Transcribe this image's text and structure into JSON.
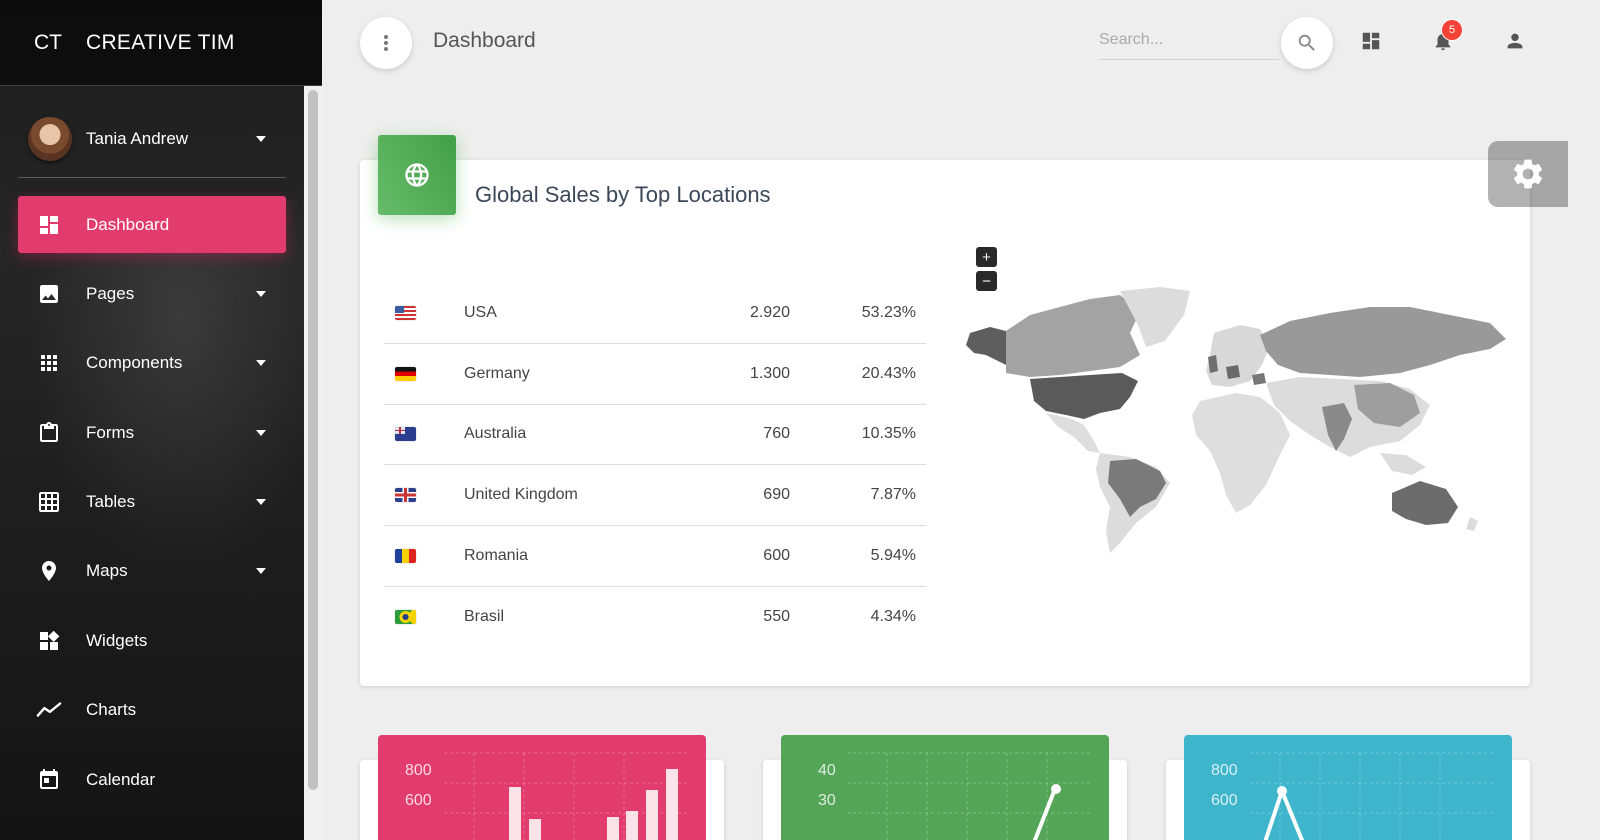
{
  "brand": {
    "mini": "CT",
    "full": "CREATIVE TIM"
  },
  "user": {
    "name": "Tania Andrew"
  },
  "nav": [
    {
      "label": "Dashboard",
      "icon": "dashboard-icon",
      "active": true,
      "caret": false
    },
    {
      "label": "Pages",
      "icon": "image-icon",
      "active": false,
      "caret": true
    },
    {
      "label": "Components",
      "icon": "apps-icon",
      "active": false,
      "caret": true
    },
    {
      "label": "Forms",
      "icon": "clipboard-icon",
      "active": false,
      "caret": true
    },
    {
      "label": "Tables",
      "icon": "grid-icon",
      "active": false,
      "caret": true
    },
    {
      "label": "Maps",
      "icon": "place-icon",
      "active": false,
      "caret": true
    },
    {
      "label": "Widgets",
      "icon": "widgets-icon",
      "active": false,
      "caret": false
    },
    {
      "label": "Charts",
      "icon": "timeline-icon",
      "active": false,
      "caret": false
    },
    {
      "label": "Calendar",
      "icon": "calendar-icon",
      "active": false,
      "caret": false
    }
  ],
  "header": {
    "title": "Dashboard",
    "search_placeholder": "Search...",
    "notification_count": "5"
  },
  "sales": {
    "title": "Global Sales by Top Locations",
    "zoom_in": "+",
    "zoom_out": "−",
    "rows": [
      {
        "country": "USA",
        "amount": "2.920",
        "percent": "53.23%",
        "flag": "us-flag-icon"
      },
      {
        "country": "Germany",
        "amount": "1.300",
        "percent": "20.43%",
        "flag": "de-flag-icon"
      },
      {
        "country": "Australia",
        "amount": "760",
        "percent": "10.35%",
        "flag": "au-flag-icon"
      },
      {
        "country": "United Kingdom",
        "amount": "690",
        "percent": "7.87%",
        "flag": "gb-flag-icon"
      },
      {
        "country": "Romania",
        "amount": "600",
        "percent": "5.94%",
        "flag": "ro-flag-icon"
      },
      {
        "country": "Brasil",
        "amount": "550",
        "percent": "4.34%",
        "flag": "br-flag-icon"
      }
    ]
  },
  "mini_charts": [
    {
      "color": "#e13c6d",
      "ticks": [
        "800",
        "600"
      ]
    },
    {
      "color": "#55a559",
      "ticks": [
        "40",
        "30"
      ]
    },
    {
      "color": "#3eb5cb",
      "ticks": [
        "800",
        "600"
      ]
    }
  ]
}
